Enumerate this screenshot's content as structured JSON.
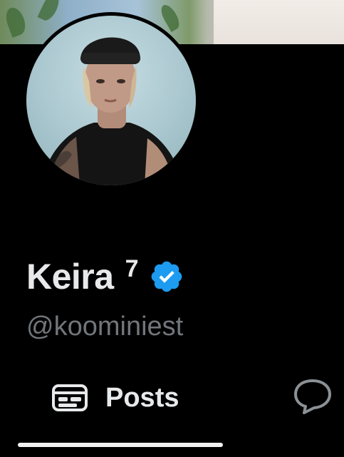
{
  "profile": {
    "display_name": "Keira",
    "name_suffix": "7",
    "handle": "@koominiest",
    "verified": true,
    "verified_color": "#1d9bf0"
  },
  "tabs": {
    "posts_label": "Posts",
    "posts_icon": "posts-icon",
    "replies_icon": "speech-bubble-icon",
    "active_tab": "Posts"
  },
  "colors": {
    "background": "#000000",
    "text_primary": "#e7e9ea",
    "text_secondary": "#71767b"
  }
}
